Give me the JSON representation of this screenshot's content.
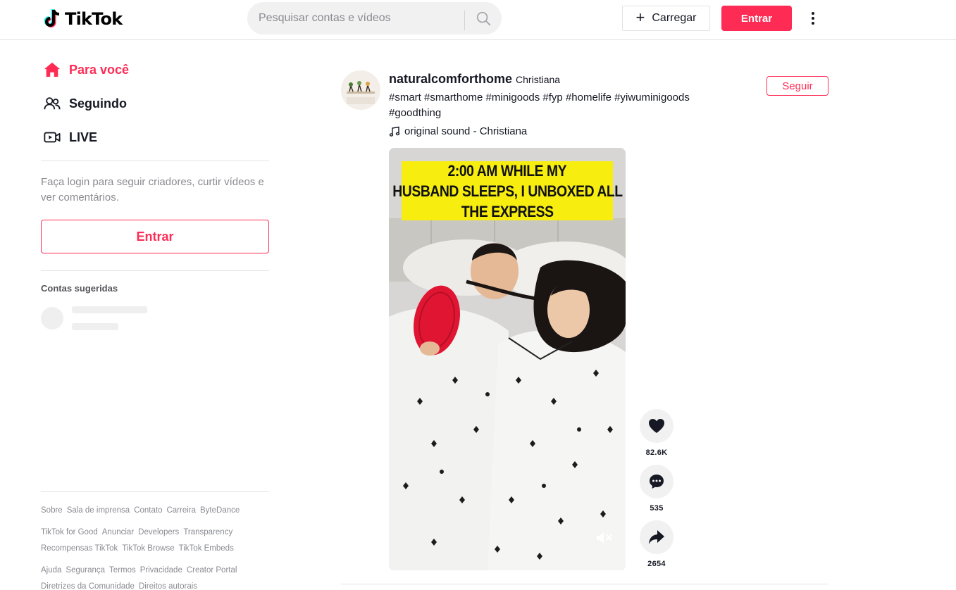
{
  "header": {
    "logo_text": "TikTok",
    "search_placeholder": "Pesquisar contas e vídeos",
    "upload_label": "Carregar",
    "login_label": "Entrar"
  },
  "sidebar": {
    "nav": [
      {
        "label": "Para você",
        "icon": "home-icon",
        "active": true
      },
      {
        "label": "Seguindo",
        "icon": "users-icon",
        "active": false
      },
      {
        "label": "LIVE",
        "icon": "live-icon",
        "active": false
      }
    ],
    "login_hint": "Faça login para seguir criadores, curtir vídeos e ver comentários.",
    "login_button": "Entrar",
    "suggested_title": "Contas sugeridas",
    "footer": {
      "row1": [
        "Sobre",
        "Sala de imprensa",
        "Contato",
        "Carreira",
        "ByteDance"
      ],
      "row2": [
        "TikTok for Good",
        "Anunciar",
        "Developers",
        "Transparency"
      ],
      "row3": [
        "Recompensas TikTok",
        "TikTok Browse",
        "TikTok Embeds"
      ],
      "row4": [
        "Ajuda",
        "Segurança",
        "Termos",
        "Privacidade",
        "Creator Portal"
      ],
      "row5": [
        "Diretrizes da Comunidade",
        "Direitos autorais"
      ]
    }
  },
  "post": {
    "author_id": "naturalcomforthome",
    "author_name": "Christiana",
    "description": "#smart #smarthome #minigoods #fyp #homelife #yiwuminigoods #goodthing",
    "music": "original sound - Christiana",
    "follow_label": "Seguir",
    "video_caption": [
      "2:00 AM WHILE MY",
      "HUSBAND SLEEPS, I UNBOXED ALL",
      "THE EXPRESS"
    ],
    "likes": "82.6K",
    "comments": "535",
    "shares": "2654"
  },
  "colors": {
    "brand": "#fe2c55",
    "text": "#161823",
    "muted": "#8a8b91",
    "caption_bg": "#f7ee10"
  }
}
